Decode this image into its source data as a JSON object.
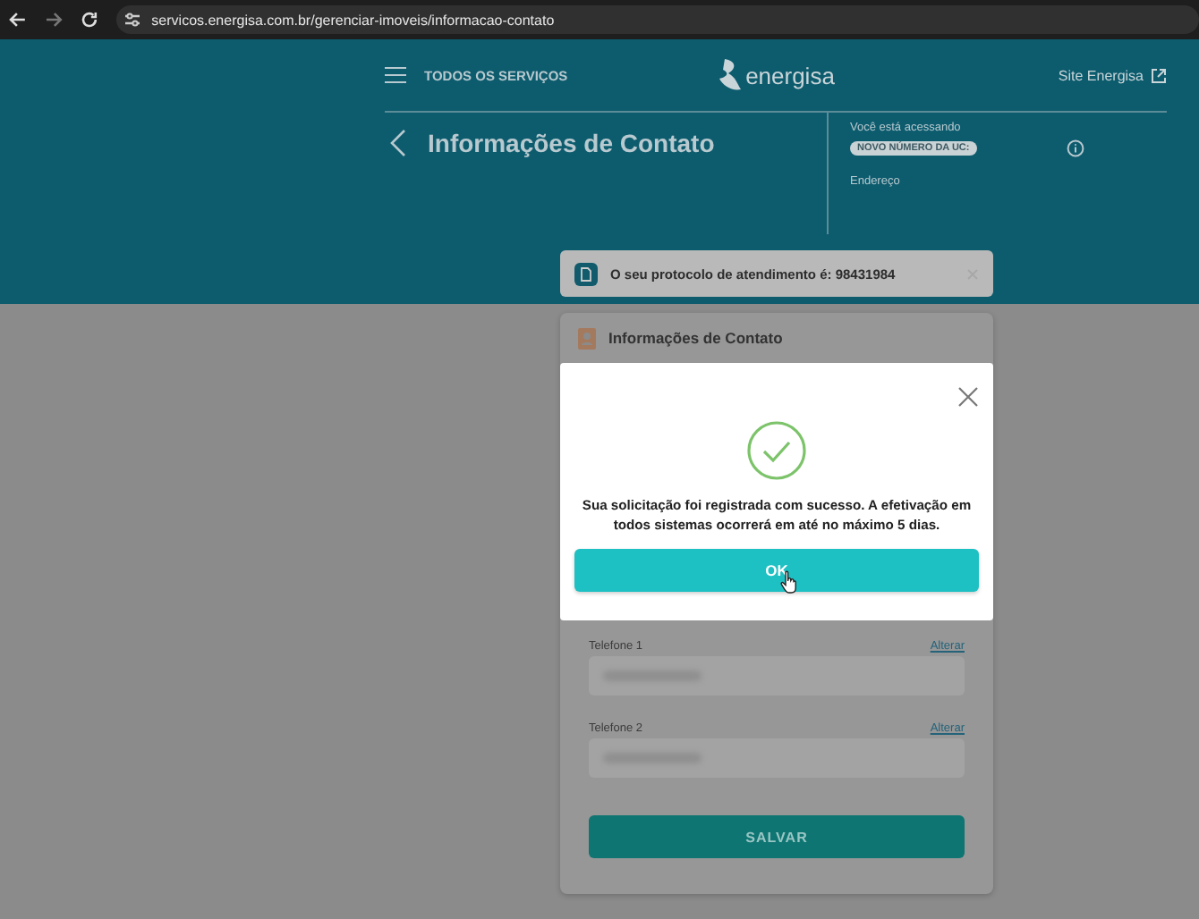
{
  "browser": {
    "url": "servicos.energisa.com.br/gerenciar-imoveis/informacao-contato"
  },
  "header": {
    "menu_label": "TODOS OS SERVIÇOS",
    "logo_text": "energisa",
    "site_link": "Site Energisa"
  },
  "page": {
    "title": "Informações de Contato",
    "access_label": "Você está acessando",
    "uc_badge": "NOVO NÚMERO DA UC:",
    "address_label": "Endereço"
  },
  "toast": {
    "text": "O seu protocolo de atendimento é: 98431984"
  },
  "card": {
    "title": "Informações de Contato",
    "fields": [
      {
        "label": "Telefone 1",
        "action": "Alterar"
      },
      {
        "label": "Telefone 2",
        "action": "Alterar"
      }
    ],
    "save_button": "SALVAR"
  },
  "modal": {
    "message": "Sua solicitação foi registrada com sucesso. A efetivação em todos sistemas ocorrerá em até no máximo 5 dias.",
    "ok_button": "OK"
  }
}
